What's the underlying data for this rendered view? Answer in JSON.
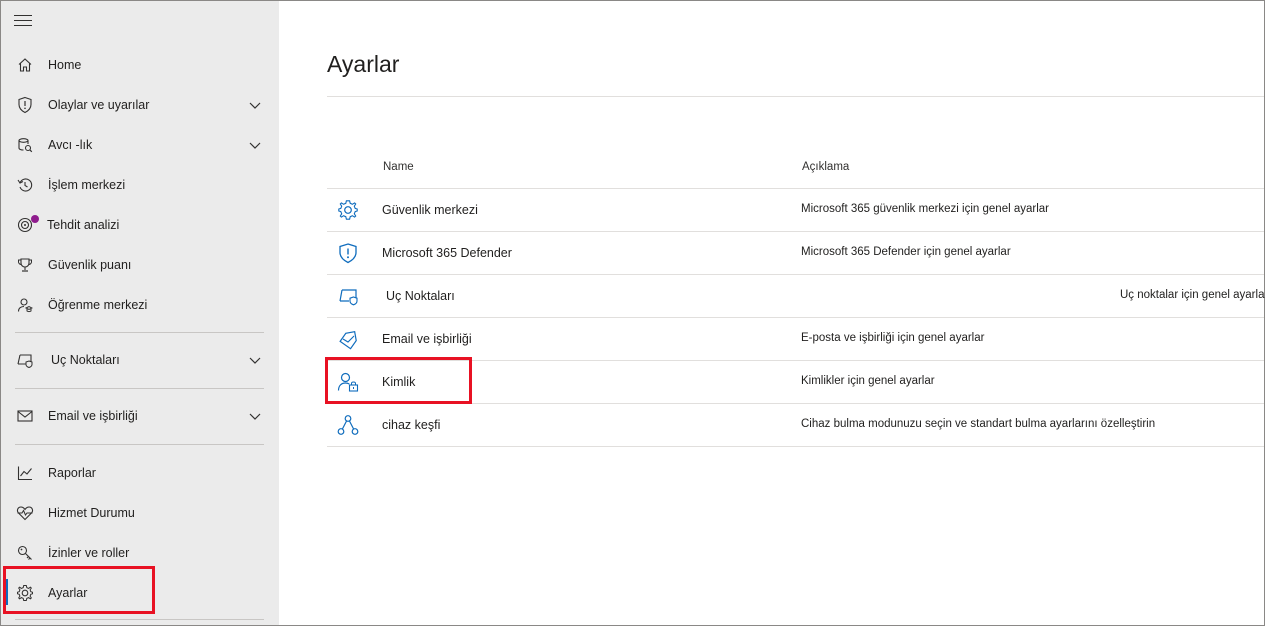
{
  "sidebar": {
    "items": [
      {
        "label": "Home",
        "icon": "home-icon"
      },
      {
        "label": "Olaylar ve uyarılar",
        "icon": "shield-icon"
      },
      {
        "label": "Avcı -lık",
        "icon": "hunting-icon"
      },
      {
        "label": "İşlem merkezi",
        "icon": "action-center-icon"
      },
      {
        "label": "Tehdit analizi",
        "icon": "threat-analytics-icon"
      },
      {
        "label": "Güvenlik puanı",
        "icon": "trophy-icon"
      },
      {
        "label": "Öğrenme merkezi",
        "icon": "learning-icon"
      },
      {
        "label": "Uç Noktaları",
        "icon": "endpoints-icon"
      },
      {
        "label": "Email ve işbirliği",
        "icon": "mail-icon"
      },
      {
        "label": "Raporlar",
        "icon": "chart-icon"
      },
      {
        "label": "Hizmet Durumu",
        "icon": "heart-icon"
      },
      {
        "label": "İzinler ve roller",
        "icon": "key-icon"
      },
      {
        "label": "Ayarlar",
        "icon": "gear-icon"
      }
    ]
  },
  "main": {
    "title": "Ayarlar",
    "columns": {
      "name": "Name",
      "description": "Açıklama"
    },
    "rows": [
      {
        "name": "Güvenlik merkezi",
        "description": "Microsoft 365 güvenlik merkezi için genel ayarlar",
        "icon": "gear-icon"
      },
      {
        "name": "Microsoft 365 Defender",
        "description": "Microsoft 365 Defender için genel ayarlar",
        "icon": "shield-icon"
      },
      {
        "name": "Uç Noktaları",
        "description": "Uç noktalar için genel ayarlar",
        "icon": "endpoints-icon"
      },
      {
        "name": "Email ve işbirliği",
        "description": "E-posta ve işbirliği için genel ayarlar",
        "icon": "mail-tag-icon"
      },
      {
        "name": "Kimlik",
        "description": "Kimlikler için genel ayarlar",
        "icon": "identity-icon"
      },
      {
        "name": "cihaz keşfi",
        "description": "Cihaz bulma modunuzu seçin ve standart bulma ayarlarını özelleştirin",
        "icon": "device-discovery-icon"
      }
    ]
  },
  "colors": {
    "sidebar_bg": "#ebebeb",
    "accent": "#0f6cbd",
    "highlight": "#e81123",
    "notification_dot": "#8f1c8d"
  }
}
